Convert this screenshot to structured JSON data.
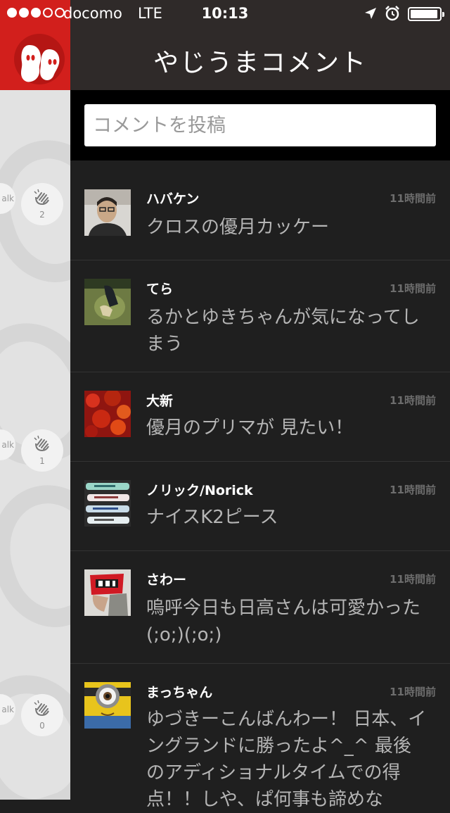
{
  "status_bar": {
    "carrier": "docomo",
    "network": "LTE",
    "time": "10:13",
    "signal_bars_filled": 3,
    "signal_bars_total": 5,
    "icons": [
      "location-arrow-icon",
      "alarm-clock-icon",
      "battery-icon"
    ],
    "battery_level": 0.9
  },
  "header": {
    "title": "やじうまコメント",
    "logo_icon": "yajiuma-ghost-logo"
  },
  "comment_input": {
    "placeholder": "コメントを投稿",
    "value": ""
  },
  "side_panel": {
    "groups": [
      {
        "talk_label": "alk",
        "clap_count": "2"
      },
      {
        "talk_label": "alk",
        "clap_count": "1"
      },
      {
        "talk_label": "alk",
        "clap_count": "0"
      }
    ]
  },
  "comments": [
    {
      "name": "ハバケン",
      "time": "11時間前",
      "text": "クロスの優月カッケー"
    },
    {
      "name": "てら",
      "time": "11時間前",
      "text": "るかとゆきちゃんが気になってしまう"
    },
    {
      "name": "大新",
      "time": "11時間前",
      "text": "優月のプリマが 見たい！"
    },
    {
      "name": "ノリック/Norick",
      "time": "11時間前",
      "text": "ナイスK2ピース"
    },
    {
      "name": "さわー",
      "time": "11時間前",
      "text": "嗚呼今日も日高さんは可愛かった(;o;)(;o;)"
    },
    {
      "name": "まっちゃん",
      "time": "11時間前",
      "text": "ゆづきーこんばんわー！ 日本、イングランドに勝ったよ^_^ 最後のアディショナルタイムでの得点！！しや、ぱ何事も諦めな"
    }
  ],
  "colors": {
    "brand_red": "#d21f1c",
    "header_bg": "#2f2a29",
    "list_bg": "#1f1f1f"
  }
}
